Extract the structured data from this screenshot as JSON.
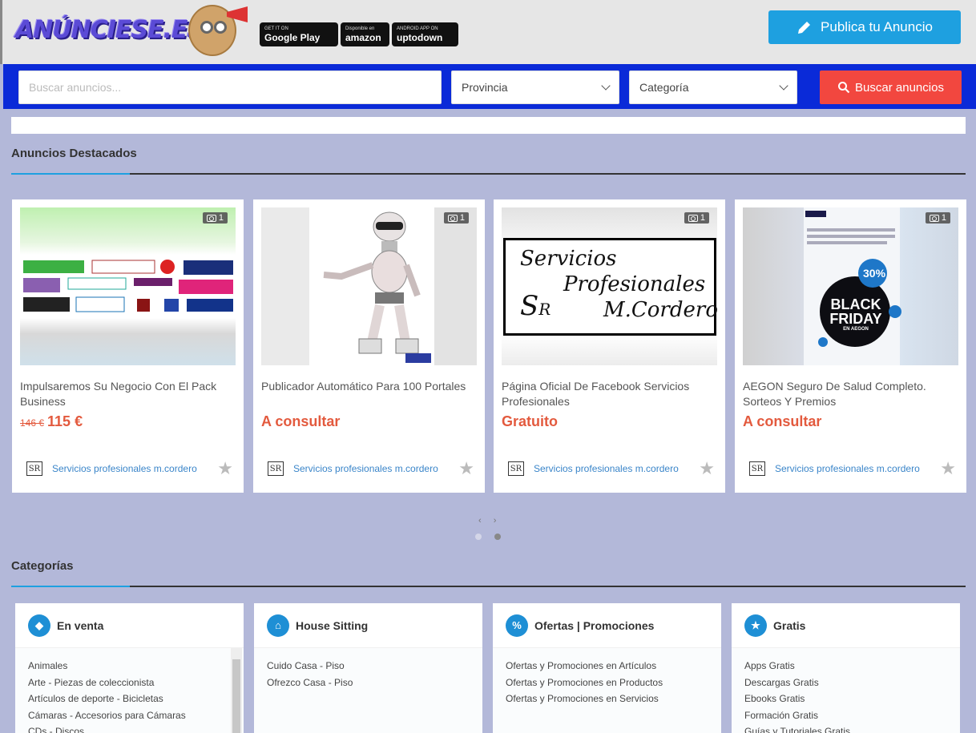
{
  "header": {
    "logo_text": "ANÚNCIESE.ES",
    "stores": [
      {
        "small": "GET IT ON",
        "big": "Google Play"
      },
      {
        "small": "Disponible en",
        "big": "amazon"
      },
      {
        "small": "ANDROID APP ON",
        "big": "uptodown"
      }
    ],
    "publish_label": "Publica tu Anuncio"
  },
  "search": {
    "placeholder": "Buscar anuncios...",
    "province_label": "Provincia",
    "category_label": "Categoría",
    "button_label": "Buscar anuncios"
  },
  "featured": {
    "title": "Anuncios Destacados",
    "cards": [
      {
        "photos": "1",
        "title": "Impulsaremos Su Negocio Con El Pack Business",
        "old_price": "146 €",
        "price": "115 €",
        "seller": "Servicios profesionales m.cordero"
      },
      {
        "photos": "1",
        "title": "Publicador Automático Para 100 Portales",
        "old_price": "",
        "price": "A consultar",
        "seller": "Servicios profesionales m.cordero"
      },
      {
        "photos": "1",
        "title": "Página Oficial De Facebook Servicios Profesionales",
        "old_price": "",
        "price": "Gratuito",
        "seller": "Servicios profesionales m.cordero"
      },
      {
        "photos": "1",
        "title": "AEGON Seguro De Salud Completo. Sorteos Y Premios",
        "old_price": "",
        "price": "A consultar",
        "seller": "Servicios profesionales m.cordero"
      }
    ],
    "card3_image_text": [
      "Servicios",
      "Profesionales",
      "M.Cordero"
    ],
    "card4_image_text": [
      "30%",
      "BLACK",
      "FRIDAY",
      "EN AEGON"
    ],
    "pager": "‹ ›"
  },
  "categories": {
    "title": "Categorías",
    "boxes": [
      {
        "name": "En venta",
        "icon": "tag-icon",
        "items": [
          "Animales",
          "Arte - Piezas de coleccionista",
          "Artículos de deporte - Bicicletas",
          "Cámaras - Accesorios para Cámaras",
          "CDs - Discos"
        ]
      },
      {
        "name": "House Sitting",
        "icon": "house-icon",
        "items": [
          "Cuido Casa - Piso",
          "Ofrezco Casa - Piso"
        ]
      },
      {
        "name": "Ofertas | Promociones",
        "icon": "percent-icon",
        "items": [
          "Ofertas y Promociones en Artículos",
          "Ofertas y Promociones en Productos",
          "Ofertas y Promociones en Servicios"
        ]
      },
      {
        "name": "Gratis",
        "icon": "star-icon",
        "items": [
          "Apps Gratis",
          "Descargas Gratis",
          "Ebooks Gratis",
          "Formación Gratis",
          "Guías y Tutoriales Gratis"
        ]
      }
    ]
  },
  "colors": {
    "brand_blue": "#0a2ad8",
    "accent": "#1ea0e0",
    "search_red": "#f2473f",
    "price": "#e35a3e"
  }
}
